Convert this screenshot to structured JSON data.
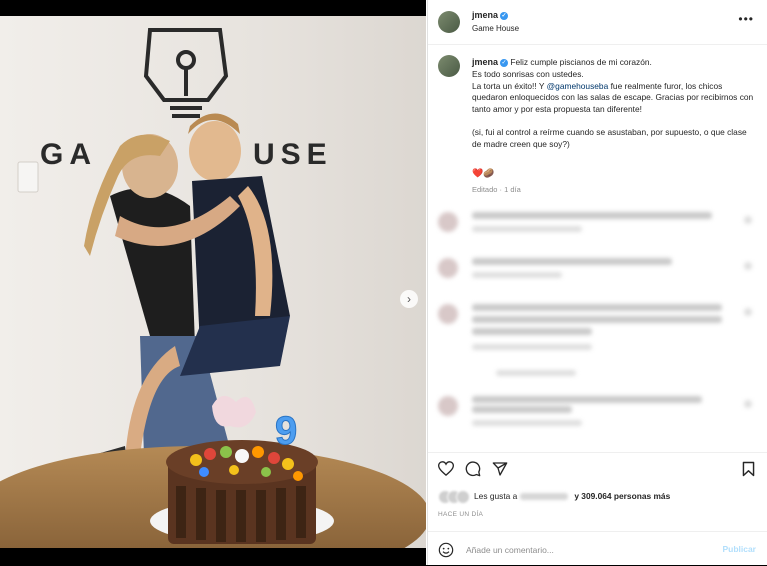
{
  "post": {
    "username": "jmena",
    "location": "Game House",
    "more_label": "•••",
    "caption_lines": [
      "Feliz cumple piscianos de mi corazón.",
      "Es todo sonrisas con ustedes.",
      "La torta un éxito!! Y",
      "@gamehouseba",
      "fue realmente furor, los chicos quedaron enloquecidos con las salas de escape. Gracias por recibirnos con tanto amor y por esta propuesta tan diferente!",
      "(si, fui al control a reírme cuando se asustaban, por supuesto, o que clase de madre creen que soy?)"
    ],
    "emojis": "❤️🥔",
    "edited": "Editado · 1 día",
    "photo_logo_text": "GAME HOUSE",
    "cake_number": "9"
  },
  "likes": {
    "prefix": "Les gusta a",
    "suffix": "y 309.064 personas más"
  },
  "timestamp": "HACE UN DÍA",
  "add_comment": {
    "placeholder": "Añade un comentario...",
    "publish_label": "Publicar"
  },
  "icons": [
    "like-icon",
    "comment-icon",
    "share-icon",
    "save-icon",
    "emoji-icon",
    "chevron-right-icon",
    "verified-icon"
  ],
  "colors": {
    "accent": "#3897f0",
    "mention": "#00376b",
    "heart": "#ed4956",
    "publish_disabled": "#b2dffc"
  }
}
